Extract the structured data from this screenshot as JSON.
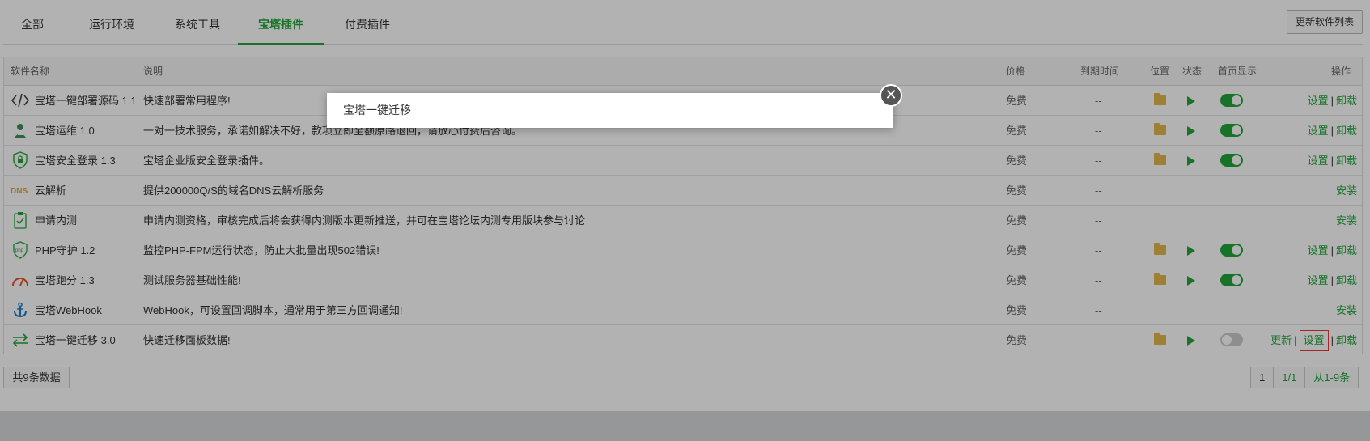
{
  "tabs": [
    {
      "label": "全部"
    },
    {
      "label": "运行环境"
    },
    {
      "label": "系统工具"
    },
    {
      "label": "宝塔插件"
    },
    {
      "label": "付费插件"
    }
  ],
  "active_tab": 3,
  "refresh_label": "更新软件列表",
  "columns": {
    "name": "软件名称",
    "desc": "说明",
    "price": "价格",
    "expire": "到期时间",
    "location": "位置",
    "status": "状态",
    "homepage": "首页显示",
    "ops": "操作"
  },
  "rows": [
    {
      "icon": "code-icon",
      "name": "宝塔一键部署源码 1.1",
      "desc": "快速部署常用程序!",
      "price": "免费",
      "expire": "--",
      "installed": true,
      "home_on": true,
      "ops": [
        "设置",
        "卸载"
      ]
    },
    {
      "icon": "support-agent-icon",
      "name": "宝塔运维 1.0",
      "desc": "一对一技术服务，承诺如解决不好，款项立即全额原路退回，请放心付费后咨询。",
      "price": "免费",
      "expire": "--",
      "installed": true,
      "home_on": true,
      "ops": [
        "设置",
        "卸载"
      ]
    },
    {
      "icon": "shield-lock-icon",
      "name": "宝塔安全登录 1.3",
      "desc": "宝塔企业版安全登录插件。",
      "price": "免费",
      "expire": "--",
      "installed": true,
      "home_on": true,
      "ops": [
        "设置",
        "卸载"
      ]
    },
    {
      "icon": "dns-icon",
      "name": "云解析",
      "desc": "提供200000Q/S的域名DNS云解析服务",
      "price": "免费",
      "expire": "--",
      "installed": false,
      "ops": [
        "安装"
      ]
    },
    {
      "icon": "clipboard-check-icon",
      "name": "申请内测",
      "desc": "申请内测资格，审核完成后将会获得内测版本更新推送，并可在宝塔论坛内测专用版块参与讨论",
      "price": "免费",
      "expire": "--",
      "installed": false,
      "ops": [
        "安装"
      ]
    },
    {
      "icon": "php-shield-icon",
      "name": "PHP守护 1.2",
      "desc": "监控PHP-FPM运行状态，防止大批量出现502错误!",
      "price": "免费",
      "expire": "--",
      "installed": true,
      "home_on": true,
      "ops": [
        "设置",
        "卸载"
      ]
    },
    {
      "icon": "speedometer-icon",
      "name": "宝塔跑分 1.3",
      "desc": "测试服务器基础性能!",
      "price": "免费",
      "expire": "--",
      "installed": true,
      "home_on": true,
      "ops": [
        "设置",
        "卸载"
      ]
    },
    {
      "icon": "anchor-icon",
      "name": "宝塔WebHook",
      "desc": "WebHook，可设置回调脚本，通常用于第三方回调通知!",
      "price": "免费",
      "expire": "--",
      "installed": false,
      "ops": [
        "安装"
      ]
    },
    {
      "icon": "transfer-arrows-icon",
      "name": "宝塔一键迁移 3.0",
      "desc": "快速迁移面板数据!",
      "price": "免费",
      "expire": "--",
      "installed": true,
      "home_on": false,
      "ops": [
        "更新",
        "设置",
        "卸载"
      ],
      "highlight_op": 1
    }
  ],
  "total_label": "共9条数据",
  "pager": [
    "1",
    "1/1",
    "从1-9条"
  ],
  "modal": {
    "title": "宝塔一键迁移",
    "close": "✕"
  },
  "colors": {
    "accent": "#20a53a",
    "folder": "#e3b749",
    "highlight": "#e53935"
  }
}
